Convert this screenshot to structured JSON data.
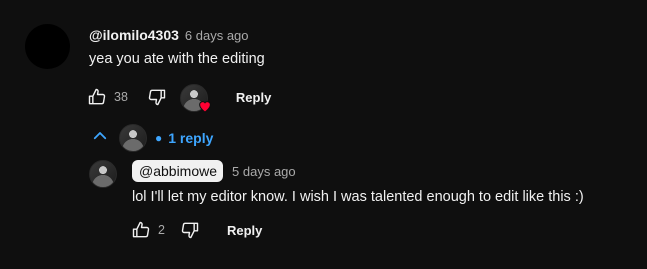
{
  "comment": {
    "author": "@ilomilo4303",
    "time": "6 days ago",
    "text": "yea you ate with the editing",
    "likes": "38",
    "reply_label": "Reply"
  },
  "replies_toggle": {
    "label": "1 reply"
  },
  "reply": {
    "author": "@abbimowe",
    "time": "5 days ago",
    "text": "lol I'll let my editor know. I wish I was talented enough to edit like this :)",
    "likes": "2",
    "reply_label": "Reply"
  },
  "colors": {
    "background": "#0f0f0f",
    "link_blue": "#3ea6ff",
    "heart_red": "#ff0033"
  }
}
